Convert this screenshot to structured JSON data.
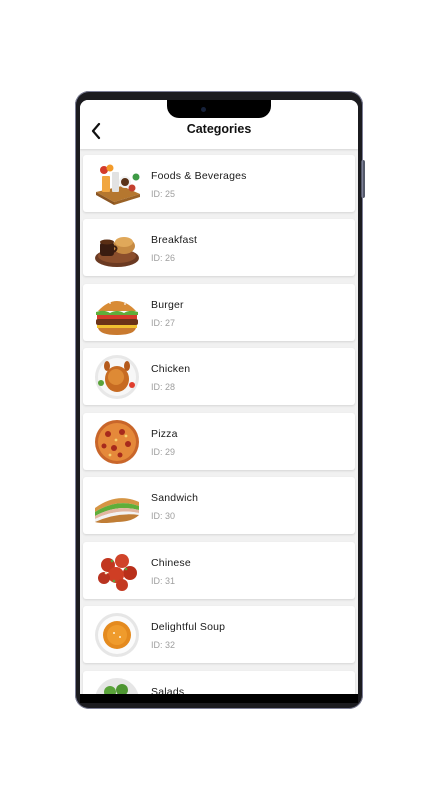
{
  "header": {
    "title": "Categories",
    "back_icon": "chevron-left-icon"
  },
  "categories": [
    {
      "name": "Foods & Beverages",
      "id": "ID: 25",
      "icon": "foods-beverages-image"
    },
    {
      "name": "Breakfast",
      "id": "ID: 26",
      "icon": "breakfast-image"
    },
    {
      "name": "Burger",
      "id": "ID: 27",
      "icon": "burger-image"
    },
    {
      "name": "Chicken",
      "id": "ID: 28",
      "icon": "chicken-image"
    },
    {
      "name": "Pizza",
      "id": "ID: 29",
      "icon": "pizza-image"
    },
    {
      "name": "Sandwich",
      "id": "ID: 30",
      "icon": "sandwich-image"
    },
    {
      "name": "Chinese",
      "id": "ID: 31",
      "icon": "chinese-image"
    },
    {
      "name": "Delightful Soup",
      "id": "ID: 32",
      "icon": "soup-image"
    },
    {
      "name": "Salads",
      "id": "",
      "icon": "salad-image"
    }
  ]
}
